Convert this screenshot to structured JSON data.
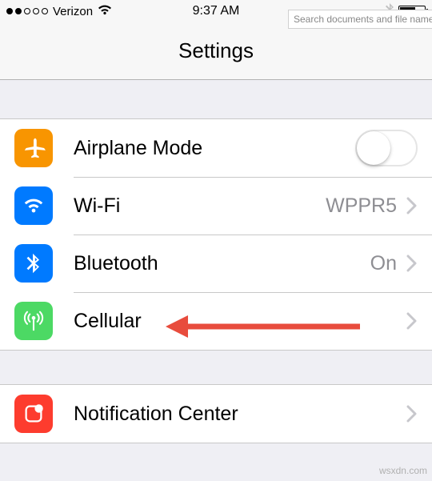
{
  "status_bar": {
    "signal_filled": 2,
    "signal_total": 5,
    "carrier": "Verizon",
    "wifi_glyph": "◴",
    "time": "9:37 AM",
    "bluetooth_glyph": ""
  },
  "search_overlay": {
    "placeholder": "Search documents and file names fo"
  },
  "nav": {
    "title": "Settings"
  },
  "group1": {
    "airplane": {
      "label": "Airplane Mode",
      "on": false
    },
    "wifi": {
      "label": "Wi-Fi",
      "value": "WPPR5"
    },
    "bluetooth": {
      "label": "Bluetooth",
      "value": "On"
    },
    "cellular": {
      "label": "Cellular"
    }
  },
  "group2": {
    "notification": {
      "label": "Notification Center"
    }
  },
  "colors": {
    "arrow": "#e84c3d"
  },
  "watermark": "wsxdn.com"
}
